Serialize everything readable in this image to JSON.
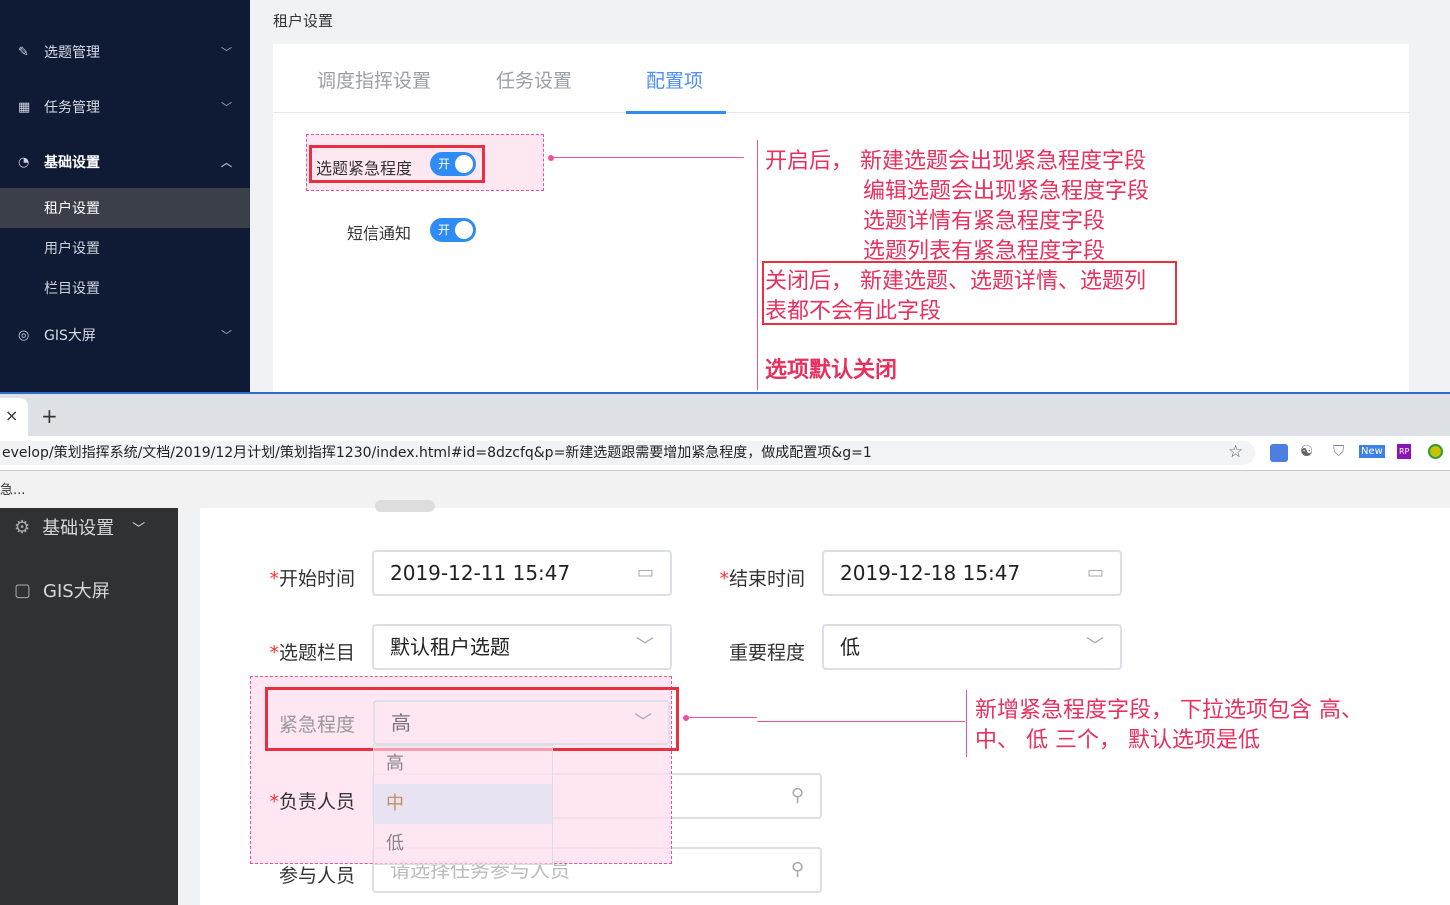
{
  "top": {
    "sidebar": [
      {
        "label": "选题管理",
        "icon": "edit-icon",
        "expanded": false
      },
      {
        "label": "任务管理",
        "icon": "table-icon",
        "expanded": false
      },
      {
        "label": "基础设置",
        "icon": "gauge-icon",
        "expanded": true,
        "children": [
          "租户设置",
          "用户设置",
          "栏目设置"
        ]
      },
      {
        "label": "GIS大屏",
        "icon": "check-circle-icon",
        "expanded": false
      }
    ],
    "breadcrumb": "租户设置",
    "tabs": [
      "调度指挥设置",
      "任务设置",
      "配置项"
    ],
    "active_tab": "配置项",
    "settings": [
      {
        "label": "选题紧急程度",
        "toggle": "开"
      },
      {
        "label": "短信通知",
        "toggle": "开"
      }
    ],
    "annotation": {
      "on_lines": [
        "开启后，  新建选题会出现紧急程度字段",
        "编辑选题会出现紧急程度字段",
        "选题详情有紧急程度字段",
        "选题列表有紧急程度字段"
      ],
      "off_lines": [
        "关闭后，  新建选题、选题详情、选题列",
        "表都不会有此字段"
      ],
      "default": "选项默认关闭"
    }
  },
  "browser": {
    "tab_close": "×",
    "new_tab": "+",
    "url": "evelop/策划指挥系统/文档/2019/12月计划/策划指挥1230/index.html#id=8dzcfq&p=新建选题跟需要增加紧急程度，做成配置项&g=1",
    "bookmark": "急...",
    "ext_new": "New",
    "ext_rp": "RP"
  },
  "bottom": {
    "sidebar": [
      {
        "label": "基础设置",
        "icon": "gear-icon"
      },
      {
        "label": "GIS大屏",
        "icon": "screen-icon"
      }
    ],
    "form": {
      "start_label": "开始时间",
      "start_value": "2019-12-11 15:47",
      "end_label": "结束时间",
      "end_value": "2019-12-18 15:47",
      "column_label": "选题栏目",
      "column_value": "默认租户选题",
      "importance_label": "重要程度",
      "importance_value": "低",
      "urgency_label": "紧急程度",
      "urgency_value": "高",
      "urgency_options": [
        "高",
        "中",
        "低"
      ],
      "owner_label": "负责人员",
      "participant_label": "参与人员",
      "participant_placeholder": "请选择任务参与人员"
    },
    "annotation": [
      "新增紧急程度字段，  下拉选项包含 高、",
      "中、 低 三个，  默认选项是低"
    ]
  },
  "colors": {
    "annotation": "#e8305f",
    "accent": "#2f8cf5",
    "sidebar": "#0f1b35"
  }
}
